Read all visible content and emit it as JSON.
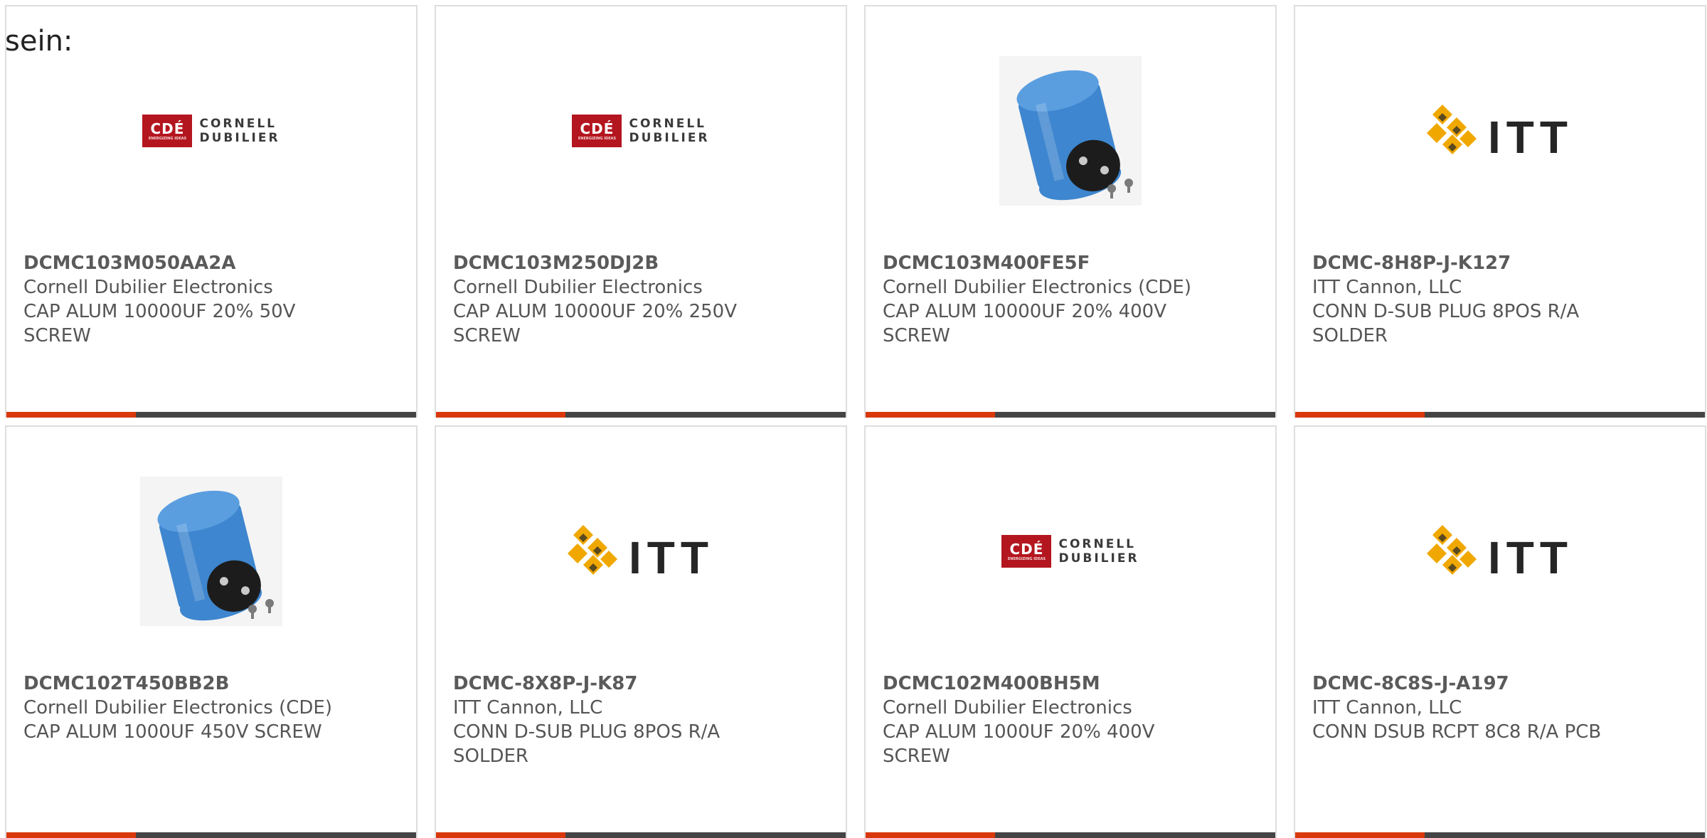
{
  "intro_text": "sein:",
  "colors": {
    "accent": "#d9380c",
    "bar_dark": "#444444",
    "card_border": "#dedede",
    "text": "#555555",
    "cde_red": "#b4161f",
    "itt_gold": "#f0a800",
    "capacitor_blue": "#3e86cf"
  },
  "cards": [
    {
      "part_number": "DCMC103M050AA2A",
      "manufacturer": "Cornell Dubilier Electronics",
      "description": "CAP ALUM 10000UF 20% 50V\nSCREW",
      "image": "cde-logo"
    },
    {
      "part_number": "DCMC103M250DJ2B",
      "manufacturer": "Cornell Dubilier Electronics",
      "description": "CAP ALUM 10000UF 20% 250V\nSCREW",
      "image": "cde-logo"
    },
    {
      "part_number": "DCMC103M400FE5F",
      "manufacturer": "Cornell Dubilier Electronics (CDE)",
      "description": "CAP ALUM 10000UF 20% 400V\nSCREW",
      "image": "capacitor-photo"
    },
    {
      "part_number": "DCMC-8H8P-J-K127",
      "manufacturer": "ITT Cannon, LLC",
      "description": "CONN D-SUB PLUG 8POS R/A\nSOLDER",
      "image": "itt-logo"
    },
    {
      "part_number": "DCMC102T450BB2B",
      "manufacturer": "Cornell Dubilier Electronics (CDE)",
      "description": "CAP ALUM 1000UF 450V SCREW",
      "image": "capacitor-photo"
    },
    {
      "part_number": "DCMC-8X8P-J-K87",
      "manufacturer": "ITT Cannon, LLC",
      "description": "CONN D-SUB PLUG 8POS R/A\nSOLDER",
      "image": "itt-logo"
    },
    {
      "part_number": "DCMC102M400BH5M",
      "manufacturer": "Cornell Dubilier Electronics",
      "description": "CAP ALUM 1000UF 20% 400V\nSCREW",
      "image": "cde-logo"
    },
    {
      "part_number": "DCMC-8C8S-J-A197",
      "manufacturer": "ITT Cannon, LLC",
      "description": "CONN DSUB RCPT 8C8 R/A PCB",
      "image": "itt-logo"
    }
  ],
  "logos": {
    "cde_mark": "CDÉ",
    "cde_tagline": "ENERGIZING IDEAS",
    "cde_line1": "CORNELL",
    "cde_line2": "DUBILIER",
    "itt_word": "ITT"
  }
}
